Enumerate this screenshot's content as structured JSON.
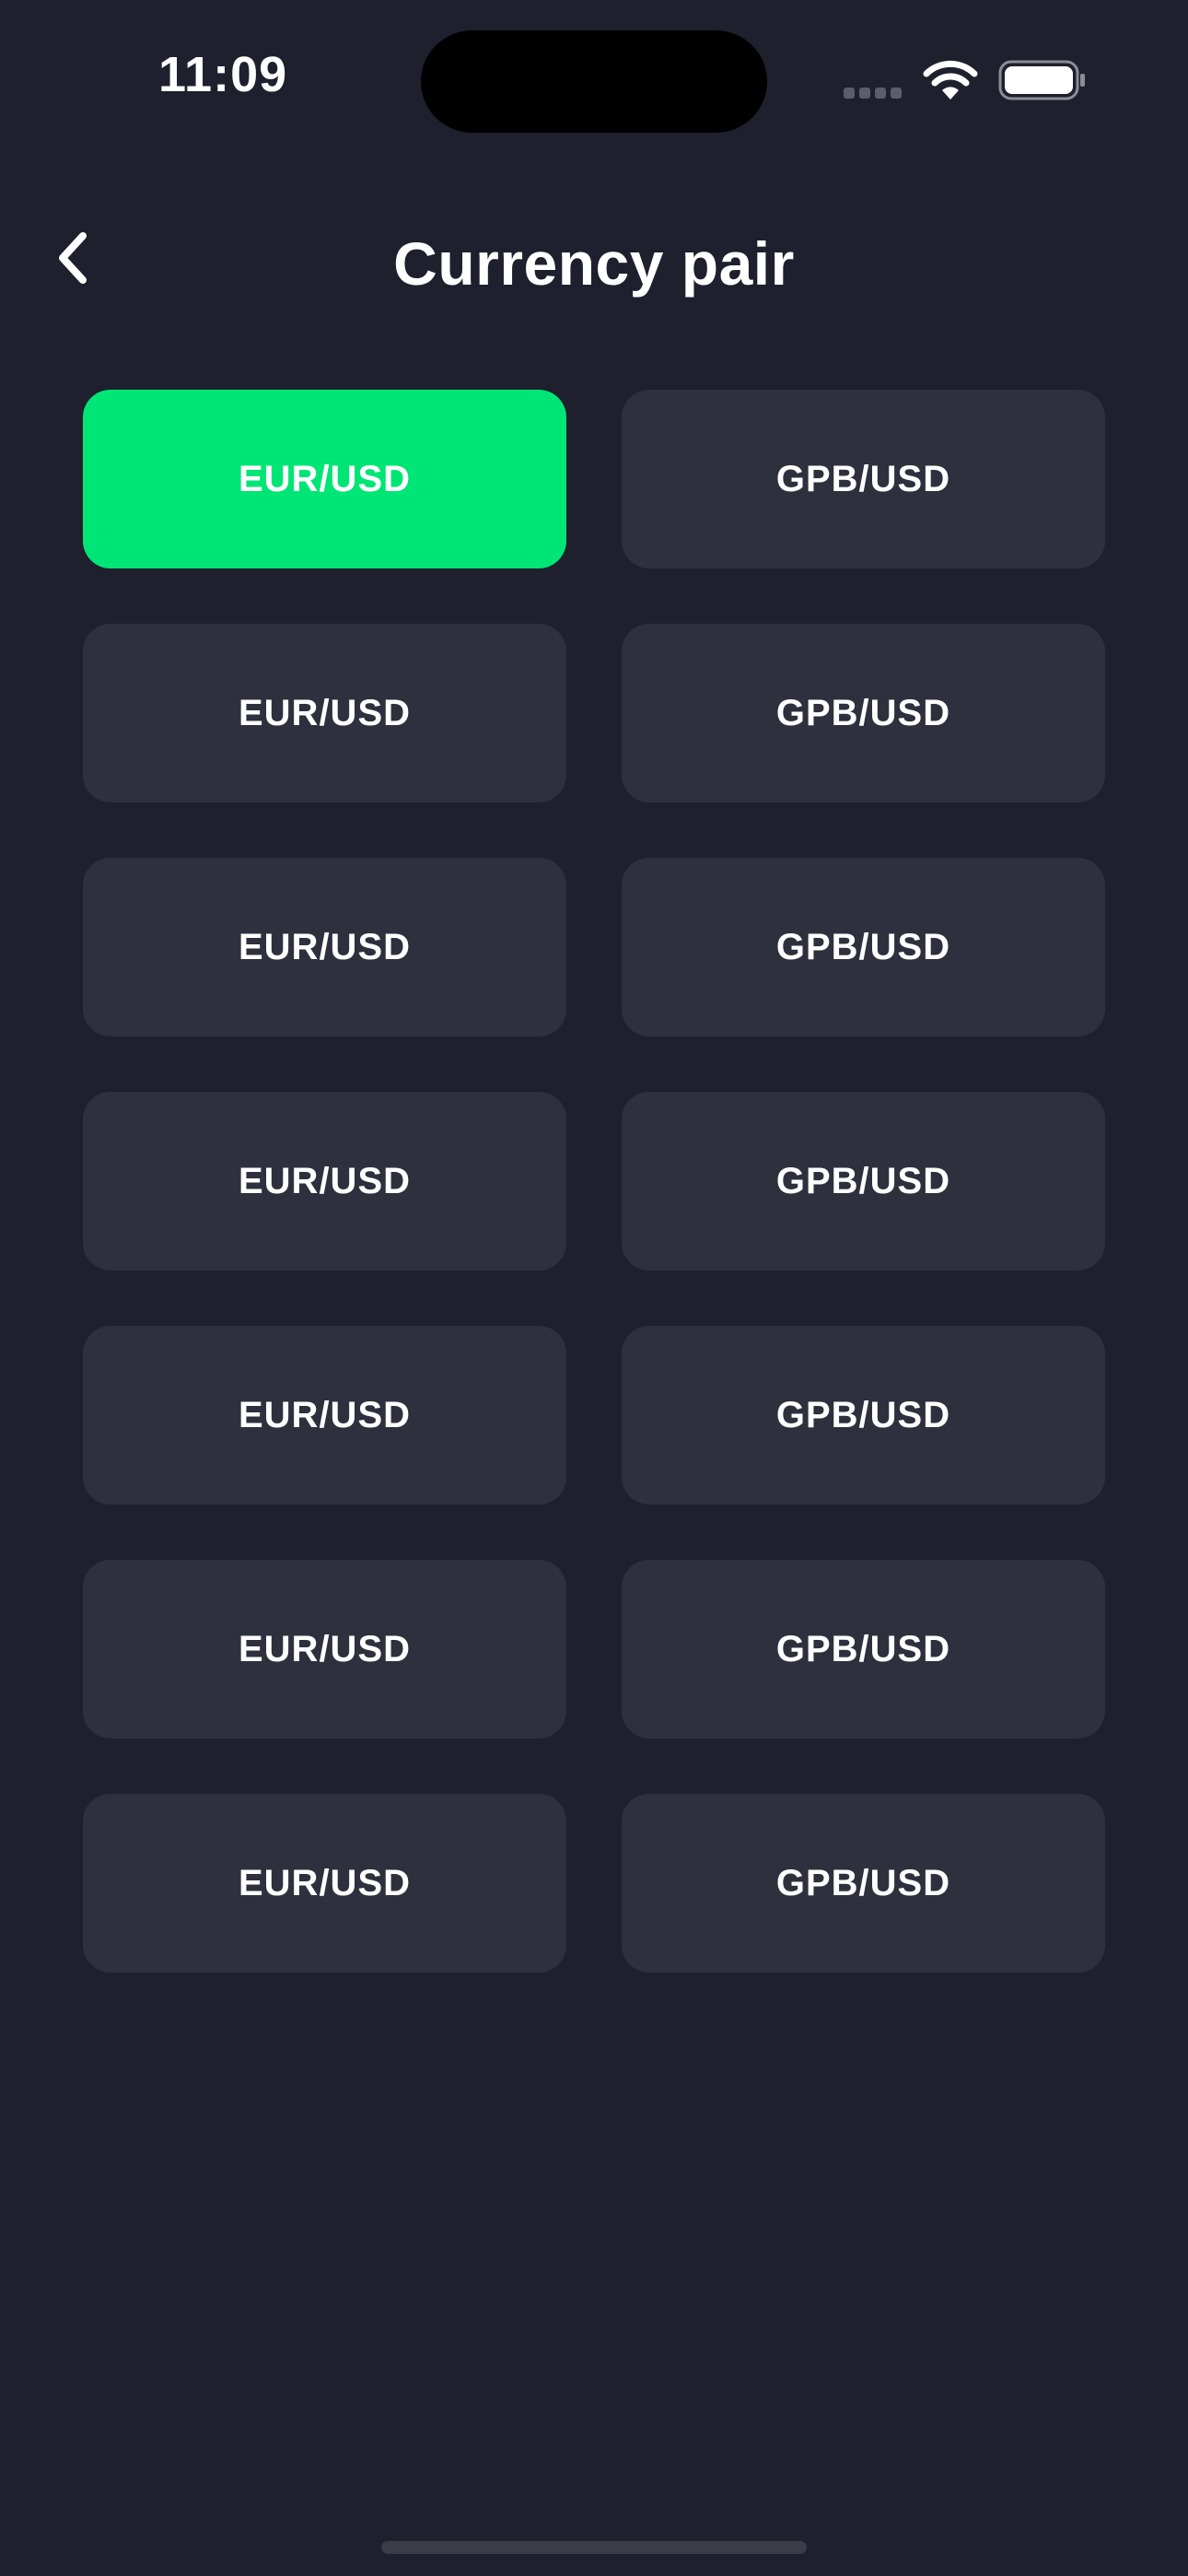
{
  "status_bar": {
    "time": "11:09"
  },
  "header": {
    "title": "Currency pair",
    "back_icon": "chevron-left-icon"
  },
  "pairs": [
    {
      "label": "EUR/USD",
      "selected": true
    },
    {
      "label": "GPB/USD",
      "selected": false
    },
    {
      "label": "EUR/USD",
      "selected": false
    },
    {
      "label": "GPB/USD",
      "selected": false
    },
    {
      "label": "EUR/USD",
      "selected": false
    },
    {
      "label": "GPB/USD",
      "selected": false
    },
    {
      "label": "EUR/USD",
      "selected": false
    },
    {
      "label": "GPB/USD",
      "selected": false
    },
    {
      "label": "EUR/USD",
      "selected": false
    },
    {
      "label": "GPB/USD",
      "selected": false
    },
    {
      "label": "EUR/USD",
      "selected": false
    },
    {
      "label": "GPB/USD",
      "selected": false
    },
    {
      "label": "EUR/USD",
      "selected": false
    },
    {
      "label": "GPB/USD",
      "selected": false
    }
  ],
  "colors": {
    "background": "#1e202d",
    "card": "#2e303d",
    "selected": "#00e676",
    "text": "#ffffff"
  }
}
